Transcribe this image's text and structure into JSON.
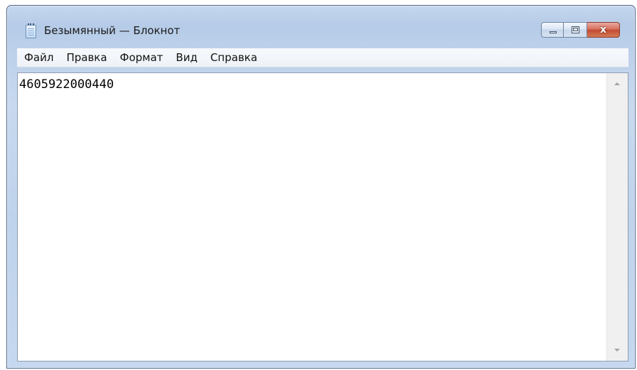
{
  "window": {
    "title": "Безымянный — Блокнот",
    "close_glyph": "x"
  },
  "menu": {
    "items": [
      {
        "label": "Файл"
      },
      {
        "label": "Правка"
      },
      {
        "label": "Формат"
      },
      {
        "label": "Вид"
      },
      {
        "label": "Справка"
      }
    ]
  },
  "editor": {
    "content": "4605922000440"
  },
  "icons": {
    "app": "notepad-icon",
    "minimize": "minimize-icon",
    "maximize": "maximize-icon",
    "close": "close-icon",
    "scroll_up": "chevron-up-icon",
    "scroll_down": "chevron-down-icon"
  },
  "colors": {
    "frame": "#bfd3ec",
    "close_button": "#c24b33",
    "editor_bg": "#ffffff"
  }
}
